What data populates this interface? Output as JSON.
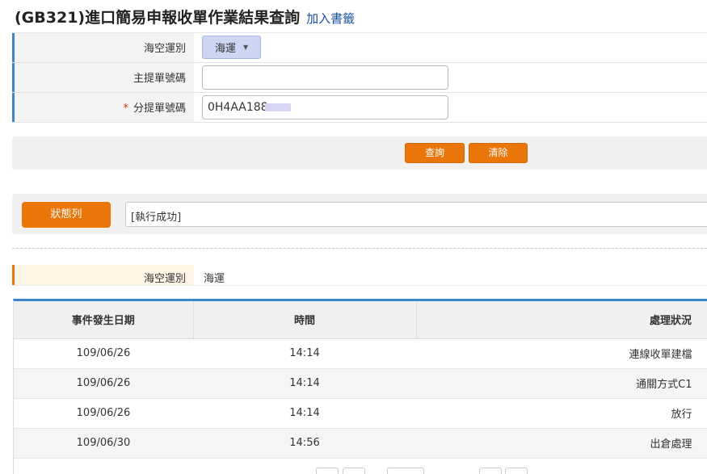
{
  "page": {
    "title": "(GB321)進口簡易申報收單作業結果查詢",
    "bookmark_label": "加入書籤"
  },
  "form": {
    "mode": {
      "label": "海空運別",
      "value": "海運"
    },
    "master_bill": {
      "label": "主提單號碼",
      "value": ""
    },
    "house_bill": {
      "required_mark": "*",
      "label": "分提單號碼",
      "value": "0H4AA188"
    }
  },
  "buttons": {
    "query": "查詢",
    "clear": "清除"
  },
  "status": {
    "button_label": "狀態列",
    "message": "[執行成功]"
  },
  "result": {
    "mode_label": "海空運別",
    "mode_value": "海運"
  },
  "table": {
    "headers": [
      "事件發生日期",
      "時間",
      "處理狀況"
    ],
    "rows": [
      {
        "date": "109/06/26",
        "time": "14:14",
        "status": "連線收單建檔"
      },
      {
        "date": "109/06/26",
        "time": "14:14",
        "status": "通關方式C1"
      },
      {
        "date": "109/06/26",
        "time": "14:14",
        "status": "放行"
      },
      {
        "date": "109/06/30",
        "time": "14:56",
        "status": "出倉處理"
      }
    ]
  },
  "colors": {
    "accent_orange": "#ea7508",
    "accent_blue": "#3a86c8",
    "link_blue": "#1a4fa0",
    "required_red": "#e0301e"
  }
}
